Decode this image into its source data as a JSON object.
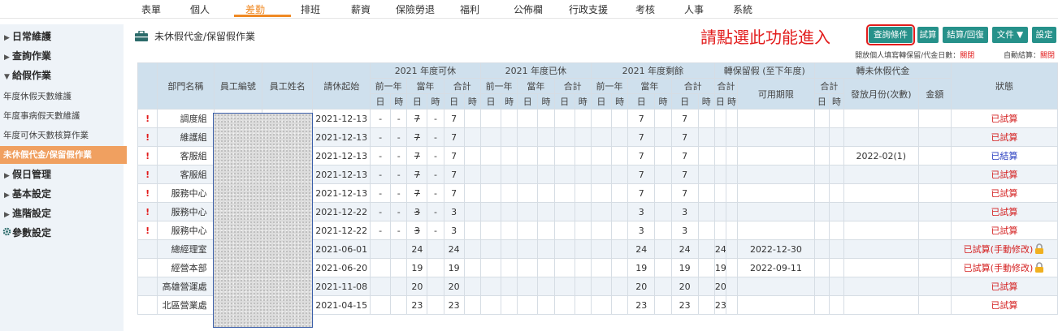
{
  "nav": {
    "items": [
      "表單",
      "個人",
      "差勤",
      "排班",
      "薪資",
      "保險勞退",
      "福利",
      "公佈欄",
      "行政支援",
      "考核",
      "人事",
      "系統"
    ],
    "active_index": 2
  },
  "sidebar": {
    "items": [
      {
        "label": "日常維護",
        "type": "group",
        "arrow": "▶"
      },
      {
        "label": "查詢作業",
        "type": "group",
        "arrow": "▶"
      },
      {
        "label": "給假作業",
        "type": "group",
        "arrow": "▼"
      },
      {
        "label": "年度休假天數維護",
        "type": "sub"
      },
      {
        "label": "年度事病假天數維護",
        "type": "sub"
      },
      {
        "label": "年度可休天數核算作業",
        "type": "sub"
      },
      {
        "label": "未休假代金/保留假作業",
        "type": "sub",
        "selected": true
      },
      {
        "label": "假日管理",
        "type": "group",
        "arrow": "▶"
      },
      {
        "label": "基本設定",
        "type": "group",
        "arrow": "▶"
      },
      {
        "label": "進階設定",
        "type": "group",
        "arrow": "▶"
      },
      {
        "label": "參數設定",
        "type": "group",
        "icon": "gear-icon"
      }
    ]
  },
  "breadcrumb": {
    "icon": "briefcase-icon",
    "title": "未休假代金/保留假作業"
  },
  "prompt": "請點選此功能進入",
  "toolbar": {
    "query": "查詢條件",
    "trial": "試算",
    "settle": "結算/回復",
    "document": "文件 ▼",
    "settings": "設定"
  },
  "info": {
    "label1": "開放個人填寫轉保留/代金日數：",
    "value1": "關閉",
    "label2": "自動結算：",
    "value2": "關閉"
  },
  "colors": {
    "accent": "#26918a",
    "active_nav": "#f08a24",
    "alert": "#e21c1c",
    "header_bg": "#cfe0ed",
    "settled": "#2a3fc0"
  },
  "table": {
    "headers": {
      "dept": "部門名稱",
      "emp_no": "員工編號",
      "emp_name": "員工姓名",
      "start": "請休起始",
      "g_avail": "2021 年度可休",
      "g_used": "2021 年度已休",
      "g_remain": "2021 年度剩餘",
      "g_carry": "轉保留假 (至下年度)",
      "g_cash": "轉未休假代金",
      "status": "狀態",
      "prev": "前一年",
      "curr": "當年",
      "total": "合計",
      "valid": "可用期限",
      "pay_month": "發放月份(次數)",
      "amount": "金額",
      "day": "日",
      "hour": "時"
    },
    "rows": [
      {
        "mark": "!",
        "dept": "調度組",
        "start": "2021-12-13",
        "ap_d": "-",
        "ap_h": "-",
        "ac_d": "7",
        "ac_strike": true,
        "ac_h": "-",
        "at_d": "7",
        "rc_d": "7",
        "rt_d": "7",
        "carry": "",
        "valid": "",
        "pay": "",
        "status": "已試算",
        "status_type": "trial"
      },
      {
        "mark": "!",
        "dept": "維護組",
        "start": "2021-12-13",
        "ap_d": "-",
        "ap_h": "-",
        "ac_d": "7",
        "ac_strike": true,
        "ac_h": "-",
        "at_d": "7",
        "rc_d": "7",
        "rt_d": "7",
        "carry": "",
        "valid": "",
        "pay": "",
        "status": "已試算",
        "status_type": "trial"
      },
      {
        "mark": "!",
        "dept": "客服組",
        "start": "2021-12-13",
        "ap_d": "-",
        "ap_h": "-",
        "ac_d": "7",
        "ac_strike": true,
        "ac_h": "-",
        "at_d": "7",
        "rc_d": "7",
        "rt_d": "7",
        "carry": "",
        "valid": "",
        "pay": "2022-02(1)",
        "status": "已結算",
        "status_type": "done"
      },
      {
        "mark": "!",
        "dept": "客服組",
        "start": "2021-12-13",
        "ap_d": "-",
        "ap_h": "-",
        "ac_d": "7",
        "ac_strike": true,
        "ac_h": "-",
        "at_d": "7",
        "rc_d": "7",
        "rt_d": "7",
        "carry": "",
        "valid": "",
        "pay": "",
        "status": "已試算",
        "status_type": "trial"
      },
      {
        "mark": "!",
        "dept": "服務中心",
        "start": "2021-12-13",
        "ap_d": "-",
        "ap_h": "-",
        "ac_d": "7",
        "ac_strike": true,
        "ac_h": "-",
        "at_d": "7",
        "rc_d": "7",
        "rt_d": "7",
        "carry": "",
        "valid": "",
        "pay": "",
        "status": "已試算",
        "status_type": "trial"
      },
      {
        "mark": "!",
        "dept": "服務中心",
        "start": "2021-12-22",
        "ap_d": "-",
        "ap_h": "-",
        "ac_d": "3",
        "ac_strike": true,
        "ac_h": "-",
        "at_d": "3",
        "rc_d": "3",
        "rt_d": "3",
        "carry": "",
        "valid": "",
        "pay": "",
        "status": "已試算",
        "status_type": "trial"
      },
      {
        "mark": "!",
        "dept": "服務中心",
        "start": "2021-12-22",
        "ap_d": "-",
        "ap_h": "-",
        "ac_d": "3",
        "ac_strike": true,
        "ac_h": "-",
        "at_d": "3",
        "rc_d": "3",
        "rt_d": "3",
        "carry": "",
        "valid": "",
        "pay": "",
        "status": "已試算",
        "status_type": "trial"
      },
      {
        "mark": "",
        "dept": "總經理室",
        "start": "2021-06-01",
        "ap_d": "",
        "ap_h": "",
        "ac_d": "24",
        "ac_strike": false,
        "ac_h": "",
        "at_d": "24",
        "rc_d": "24",
        "rt_d": "24",
        "carry": "24",
        "valid": "2022-12-30",
        "pay": "",
        "status": "已試算(手動修改)",
        "status_type": "trial",
        "lock": true
      },
      {
        "mark": "",
        "dept": "經營本部",
        "start": "2021-06-20",
        "ap_d": "",
        "ap_h": "",
        "ac_d": "19",
        "ac_strike": false,
        "ac_h": "",
        "at_d": "19",
        "rc_d": "19",
        "rt_d": "19",
        "carry": "19",
        "valid": "2022-09-11",
        "pay": "",
        "status": "已試算(手動修改)",
        "status_type": "trial",
        "lock": true
      },
      {
        "mark": "",
        "dept": "高雄營運處",
        "start": "2021-11-08",
        "ap_d": "",
        "ap_h": "",
        "ac_d": "20",
        "ac_strike": false,
        "ac_h": "",
        "at_d": "20",
        "rc_d": "20",
        "rt_d": "20",
        "carry": "20",
        "valid": "",
        "pay": "",
        "status": "已試算",
        "status_type": "trial"
      },
      {
        "mark": "",
        "dept": "北區營業處",
        "start": "2021-04-15",
        "ap_d": "",
        "ap_h": "",
        "ac_d": "23",
        "ac_strike": false,
        "ac_h": "",
        "at_d": "23",
        "rc_d": "23",
        "rt_d": "23",
        "carry": "23",
        "valid": "",
        "pay": "",
        "status": "已試算",
        "status_type": "trial"
      }
    ]
  }
}
